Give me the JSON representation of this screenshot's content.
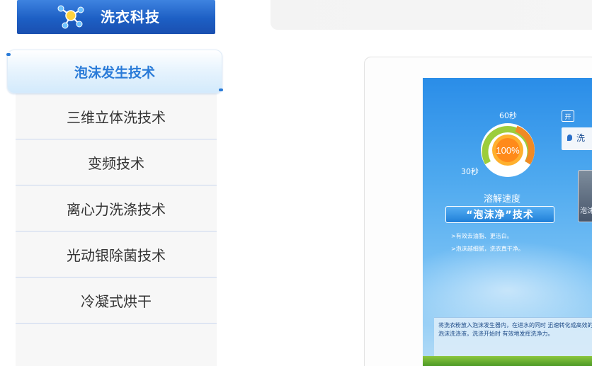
{
  "sidebar": {
    "header_title": "洗衣科技",
    "items": [
      {
        "label": "泡沫发生技术",
        "active": true
      },
      {
        "label": "三维立体洗技术",
        "active": false
      },
      {
        "label": "变频技术",
        "active": false
      },
      {
        "label": "离心力洗涤技术",
        "active": false
      },
      {
        "label": "光动银除菌技术",
        "active": false
      },
      {
        "label": "冷凝式烘干",
        "active": false
      }
    ]
  },
  "promo": {
    "gauge_top_label": "60秒",
    "gauge_left_label": "30秒",
    "gauge_value": "100%",
    "speed_label": "溶解速度",
    "banner": "“泡沫净”技术",
    "bullets": [
      ">有效去油脂、更洁白。",
      ">泡沫越细腻，洗衣真干净。"
    ],
    "switch_label": "开",
    "chip_label": "洗",
    "device_label": "泡沫",
    "caption": "将洗衣粉放入泡沫发生器内，在进水的同时 迅速转化成高效的微泡沫洗涤液，洗涤开始时 有效地发挥洗净力。"
  },
  "colors": {
    "accent": "#2a7bd8",
    "header_blue": "#1d5fc4",
    "divider": "#c9d6ee"
  }
}
